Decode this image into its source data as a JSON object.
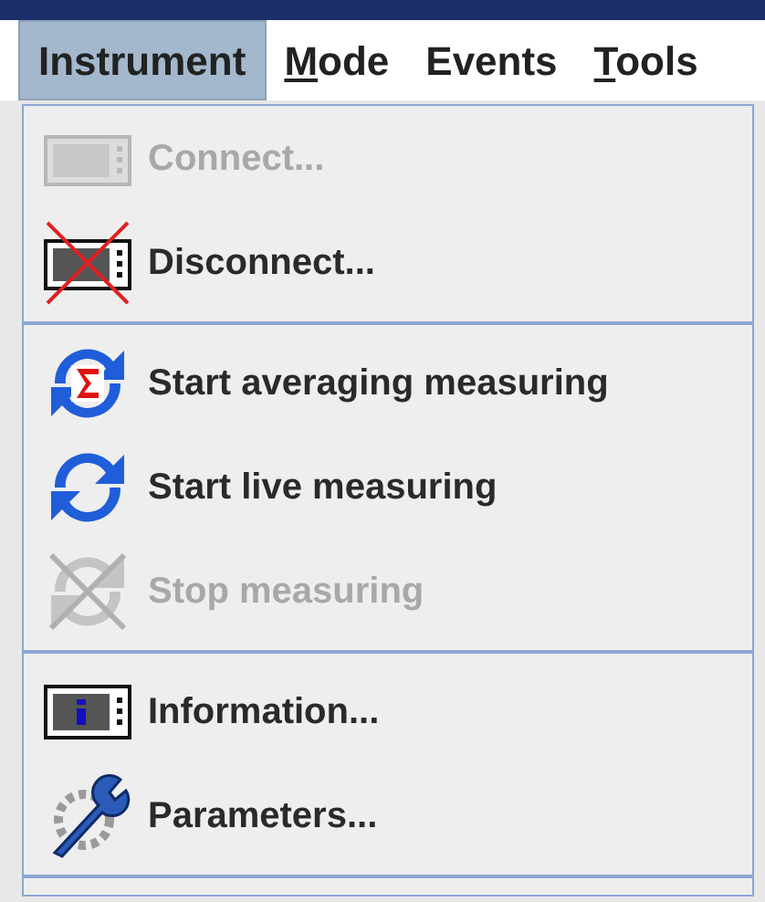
{
  "menu_bar": [
    {
      "label": "Instrument",
      "selected": true,
      "mnemonic_underlined": false
    },
    {
      "label": "Mode",
      "selected": false,
      "mnemonic_underlined": true
    },
    {
      "label": "Events",
      "selected": false,
      "mnemonic_underlined": false
    },
    {
      "label": "Tools",
      "selected": false,
      "mnemonic_underlined": true
    }
  ],
  "dropdown": [
    {
      "kind": "item",
      "label": "Connect...",
      "disabled": true
    },
    {
      "kind": "item",
      "label": "Disconnect...",
      "disabled": false
    },
    {
      "kind": "separator"
    },
    {
      "kind": "item",
      "label": "Start averaging measuring",
      "disabled": false
    },
    {
      "kind": "item",
      "label": "Start live measuring",
      "disabled": false
    },
    {
      "kind": "item",
      "label": "Stop measuring",
      "disabled": true
    },
    {
      "kind": "separator"
    },
    {
      "kind": "item",
      "label": "Information...",
      "disabled": false
    },
    {
      "kind": "item",
      "label": "Parameters...",
      "disabled": false
    },
    {
      "kind": "separator"
    }
  ]
}
